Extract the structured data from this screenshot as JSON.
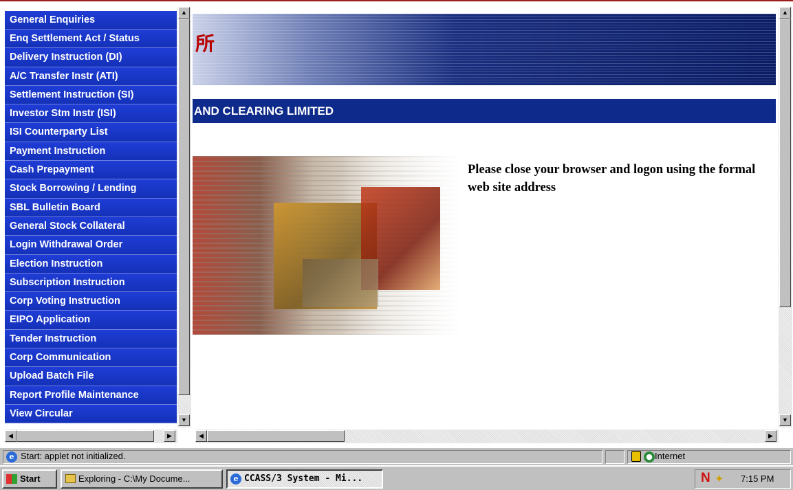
{
  "menu": {
    "items": [
      {
        "label": "General Enquiries"
      },
      {
        "label": "Enq Settlement Act / Status"
      },
      {
        "label": "Delivery Instruction (DI)"
      },
      {
        "label": "A/C Transfer Instr (ATI)"
      },
      {
        "label": "Settlement Instruction (SI)"
      },
      {
        "label": "Investor Stm Instr (ISI)"
      },
      {
        "label": "ISI Counterparty List"
      },
      {
        "label": "Payment Instruction"
      },
      {
        "label": "Cash Prepayment"
      },
      {
        "label": "Stock Borrowing / Lending"
      },
      {
        "label": "SBL Bulletin Board"
      },
      {
        "label": "General Stock Collateral"
      },
      {
        "label": "Login Withdrawal Order"
      },
      {
        "label": "Election Instruction"
      },
      {
        "label": "Subscription Instruction"
      },
      {
        "label": "Corp Voting Instruction"
      },
      {
        "label": "EIPO Application"
      },
      {
        "label": "Tender Instruction"
      },
      {
        "label": "Corp Communication"
      },
      {
        "label": "Upload Batch File"
      },
      {
        "label": "Report Profile Maintenance"
      },
      {
        "label": "View Circular"
      }
    ]
  },
  "content": {
    "banner_glyph": "所",
    "company_name": "AND CLEARING LIMITED",
    "message": "Please close your browser and logon using the formal web site address"
  },
  "status_bar": {
    "text": "Start: applet not initialized.",
    "zone": "Internet"
  },
  "taskbar": {
    "start_label": "Start",
    "tasks": [
      {
        "label": "Exploring - C:\\My Docume..."
      },
      {
        "label": "CCASS/3 System - Mi..."
      }
    ],
    "clock": "7:15 PM"
  },
  "colors": {
    "menu_blue": "#1a38c8",
    "header_navy": "#0e2a8a",
    "banner_glyph_red": "#b80000"
  }
}
